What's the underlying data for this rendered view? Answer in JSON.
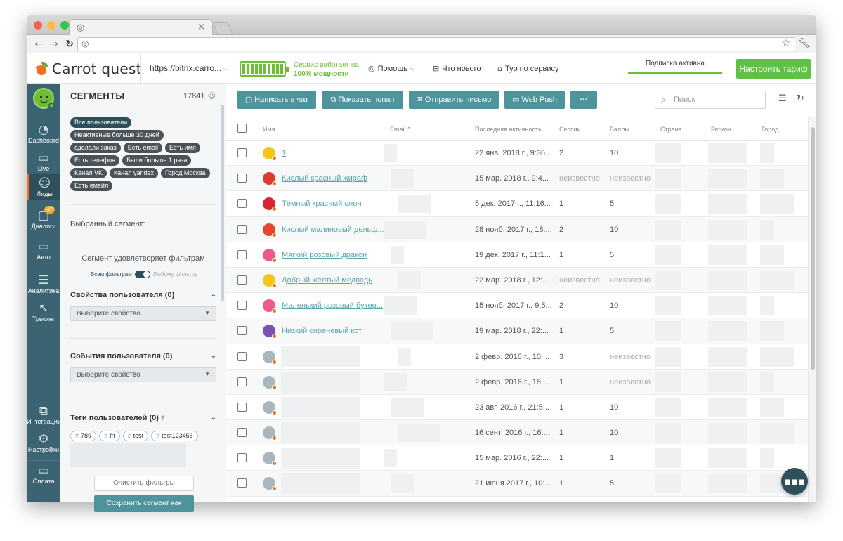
{
  "app": {
    "name": "Carrot quest",
    "site_url": "https://bitrix.carro...",
    "service_status_line1": "Сервис работает на",
    "service_status_line2": "100% мощности",
    "help": "Помощь",
    "whats_new": "Что нового",
    "tour": "Тур по сервису",
    "subscription": "Подписка активна",
    "tariff_button": "Настроить тариф",
    "brand_colors": {
      "accent": "#4d949c",
      "nav": "#3b6371",
      "green": "#6cbf35",
      "orange": "#f37021"
    }
  },
  "nav": {
    "items": [
      {
        "label": "Dashboard",
        "icon": "gauge-icon"
      },
      {
        "label": "Live",
        "icon": "monitor-pulse-icon"
      },
      {
        "label": "Лиды",
        "icon": "users-icon"
      },
      {
        "label": "Диалоги",
        "icon": "chat-icon",
        "badge": "42"
      },
      {
        "label": "Авто",
        "icon": "auto-message-icon"
      },
      {
        "label": "Аналитика",
        "icon": "funnel-icon"
      },
      {
        "label": "Трекинг",
        "icon": "cursor-icon"
      },
      {
        "label": "Интеграции",
        "icon": "puzzle-icon"
      },
      {
        "label": "Настройки",
        "icon": "gear-icon"
      },
      {
        "label": "Оплата",
        "icon": "card-icon"
      }
    ]
  },
  "segments": {
    "title": "СЕГМЕНТЫ",
    "count": "17841",
    "chips": [
      "Все пользователи",
      "Неактивные больше 30 дней",
      "сделали заказ",
      "Есть email",
      "Есть имя",
      "Есть телефон",
      "Были больше 1 раза",
      "Канал VK",
      "Канал yandex",
      "Город Москва",
      "Есть емейл"
    ],
    "selected_label": "Выбранный сегмент:",
    "match_text": "Сегмент удовлетворяет фильтрам",
    "toggle_all": "Всем фильтрам",
    "toggle_any": "Любому фильтру",
    "user_props": "Свойства пользователя (0)",
    "user_events": "События пользователя (0)",
    "user_tags": "Теги пользователей (0)",
    "select_placeholder": "Выберите свойство",
    "tags": [
      "789",
      "fn",
      "test",
      "test123456"
    ],
    "clear_button": "Очистить фильтры",
    "save_button": "Сохранить сегмент как"
  },
  "toolbar": {
    "chat": "Написать в чат",
    "popup": "Показать попап",
    "email": "Отправить письмо",
    "push": "Web Push",
    "more": "···",
    "search_placeholder": "Поиск"
  },
  "table": {
    "headers": {
      "name": "Имя",
      "email": "Email ^",
      "activity": "Последняя активность",
      "sessions": "Сессии",
      "points": "Баллы",
      "country": "Страна",
      "region": "Регион",
      "city": "Город"
    },
    "rows": [
      {
        "name": "1",
        "activity": "22 янв. 2018 г., 9:36...",
        "sessions": "2",
        "points": "10",
        "avatar": "#f5c518"
      },
      {
        "name": "Кислый красный жираф",
        "activity": "15 мар. 2018 г., 9:4...",
        "sessions": "неизвестно",
        "points": "неизвестно",
        "avatar": "#e03a2f"
      },
      {
        "name": "Тёмный красный слон",
        "activity": "5 дек. 2017 г., 11:16...",
        "sessions": "1",
        "points": "5",
        "avatar": "#d9262e"
      },
      {
        "name": "Кислый малиновый дельф...",
        "activity": "28 нояб. 2017 г., 18:...",
        "sessions": "2",
        "points": "10",
        "avatar": "#e8442f"
      },
      {
        "name": "Мягкий розовый дракон",
        "activity": "19 дек. 2017 г., 11:1...",
        "sessions": "1",
        "points": "5",
        "avatar": "#f0578a"
      },
      {
        "name": "Добрый жёлтый медведь",
        "activity": "22 мар. 2018 г., 12:...",
        "sessions": "неизвестно",
        "points": "неизвестно",
        "avatar": "#f5c518"
      },
      {
        "name": "Маленький розовый бутер...",
        "activity": "15 нояб. 2017 г., 9:5...",
        "sessions": "2",
        "points": "10",
        "avatar": "#f05a8a"
      },
      {
        "name": "Низкий сиреневый кот",
        "activity": "19 мар. 2018 г., 22:...",
        "sessions": "1",
        "points": "5",
        "avatar": "#7b4fb5"
      },
      {
        "name": "",
        "activity": "2 февр. 2016 г., 10:...",
        "sessions": "3",
        "points": "неизвестно",
        "avatar": "#a9b7bd"
      },
      {
        "name": "",
        "activity": "2 февр. 2016 г., 18:...",
        "sessions": "1",
        "points": "неизвестно",
        "avatar": "#a9b7bd"
      },
      {
        "name": "",
        "activity": "23 авг. 2016 г., 21:5...",
        "sessions": "1",
        "points": "10",
        "avatar": "#a9b7bd"
      },
      {
        "name": "",
        "activity": "16 сент. 2016 г., 16:...",
        "sessions": "1",
        "points": "10",
        "avatar": "#a9b7bd"
      },
      {
        "name": "",
        "activity": "15 мар. 2016 г., 22:...",
        "sessions": "1",
        "points": "1",
        "avatar": "#a9b7bd"
      },
      {
        "name": "",
        "activity": "21 июня 2017 г., 10:...",
        "sessions": "1",
        "points": "5",
        "avatar": "#a9b7bd"
      }
    ]
  }
}
